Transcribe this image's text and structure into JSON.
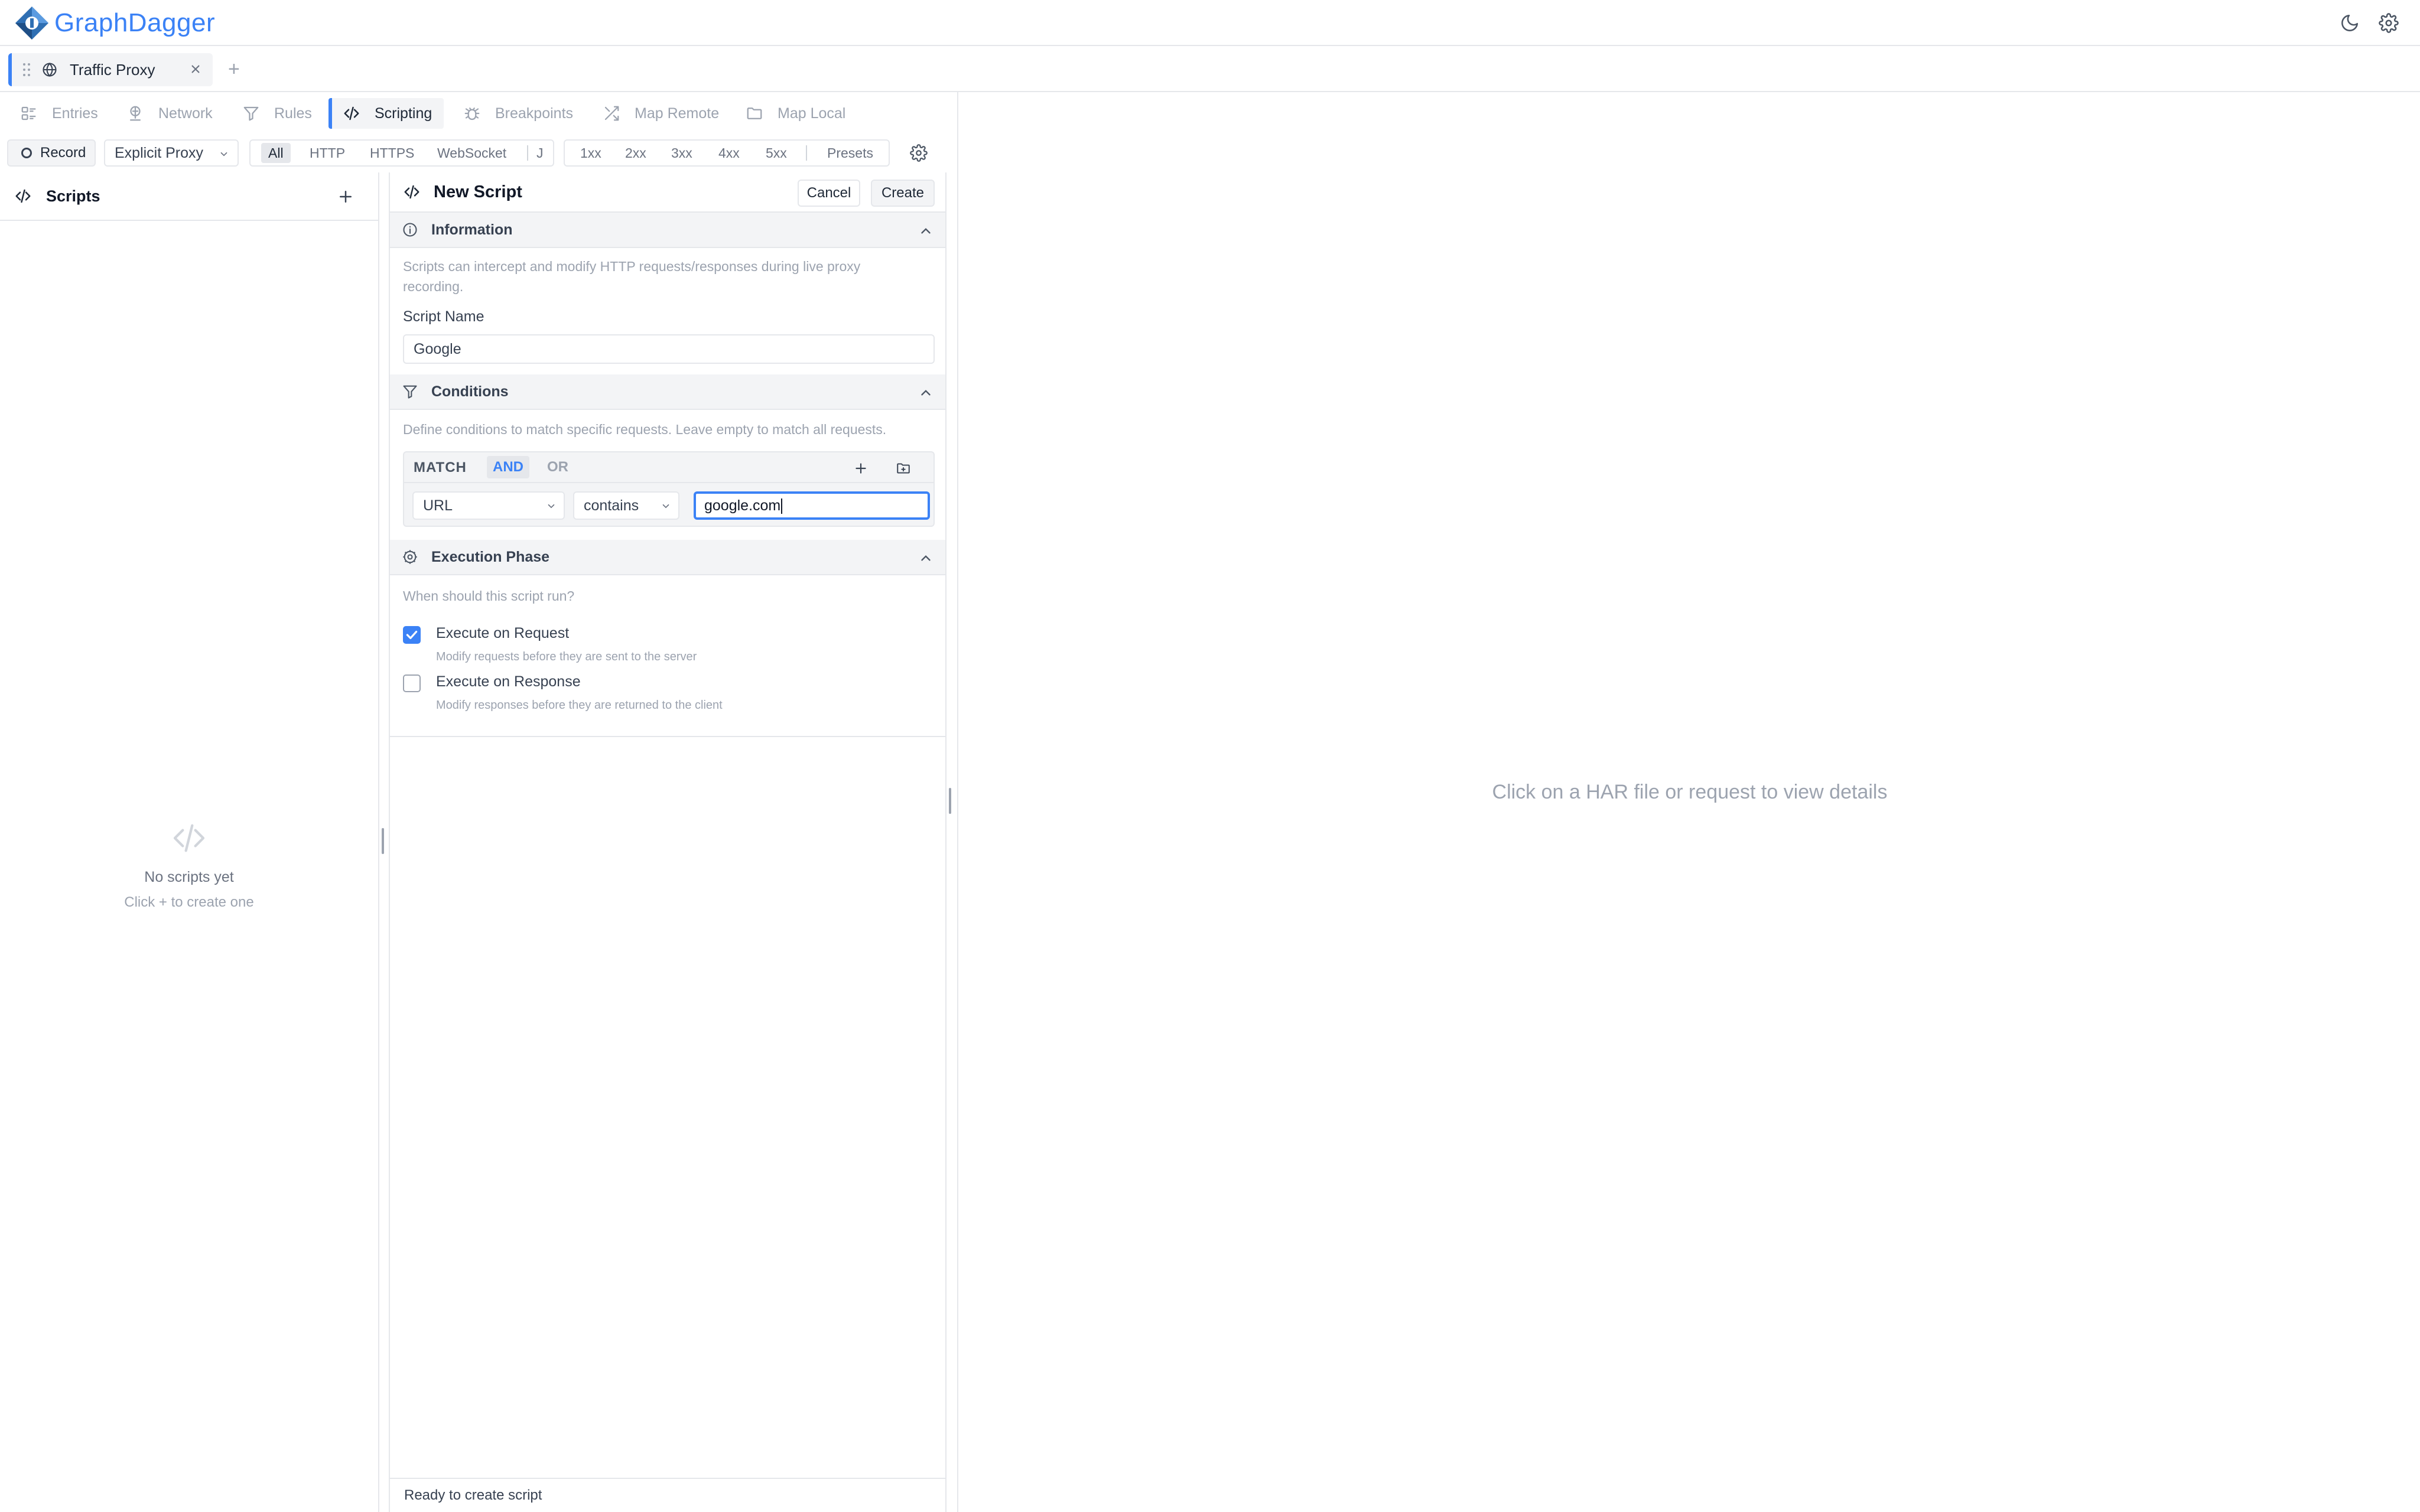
{
  "app": {
    "name": "GraphDagger",
    "brand_color": "#3b82f6",
    "icons": [
      "graphdagger-logo-icon",
      "moon-icon",
      "gear-icon"
    ]
  },
  "workspace_tabs": [
    {
      "label": "Traffic Proxy",
      "icon": "globe-icon",
      "active": true
    }
  ],
  "add_tab_label": "+",
  "nav": {
    "items": [
      {
        "label": "Entries",
        "icon": "list-icon"
      },
      {
        "label": "Network",
        "icon": "network-icon"
      },
      {
        "label": "Rules",
        "icon": "filter-icon"
      },
      {
        "label": "Scripting",
        "icon": "code-icon",
        "active": true
      },
      {
        "label": "Breakpoints",
        "icon": "bug-icon"
      },
      {
        "label": "Map Remote",
        "icon": "shuffle-icon"
      },
      {
        "label": "Map Local",
        "icon": "folder-icon"
      }
    ]
  },
  "toolbar": {
    "record_label": "Record",
    "proxy_mode": "Explicit Proxy",
    "protocols": [
      "All",
      "HTTP",
      "HTTPS",
      "WebSocket",
      "J"
    ],
    "active_protocol": "All",
    "status_filters": [
      "1xx",
      "2xx",
      "3xx",
      "4xx",
      "5xx"
    ],
    "presets_label": "Presets"
  },
  "sidebar": {
    "title": "Scripts",
    "add_label": "+",
    "empty_title": "No scripts yet",
    "empty_hint": "Click + to create one"
  },
  "editor": {
    "title": "New Script",
    "cancel_label": "Cancel",
    "create_label": "Create",
    "information": {
      "title": "Information",
      "description": "Scripts can intercept and modify HTTP requests/responses during live proxy recording.",
      "name_label": "Script Name",
      "name_value": "Google"
    },
    "conditions": {
      "title": "Conditions",
      "description": "Define conditions to match specific requests. Leave empty to match all requests.",
      "match_label": "MATCH",
      "and_label": "AND",
      "or_label": "OR",
      "active_logic": "AND",
      "rows": [
        {
          "field": "URL",
          "operator": "contains",
          "value": "google.com"
        }
      ]
    },
    "execution": {
      "title": "Execution Phase",
      "question": "When should this script run?",
      "options": [
        {
          "label": "Execute on Request",
          "description": "Modify requests before they are sent to the server",
          "checked": true
        },
        {
          "label": "Execute on Response",
          "description": "Modify responses before they are returned to the client",
          "checked": false
        }
      ]
    },
    "status": "Ready to create script"
  },
  "details": {
    "placeholder": "Click on a HAR file or request to view details"
  }
}
